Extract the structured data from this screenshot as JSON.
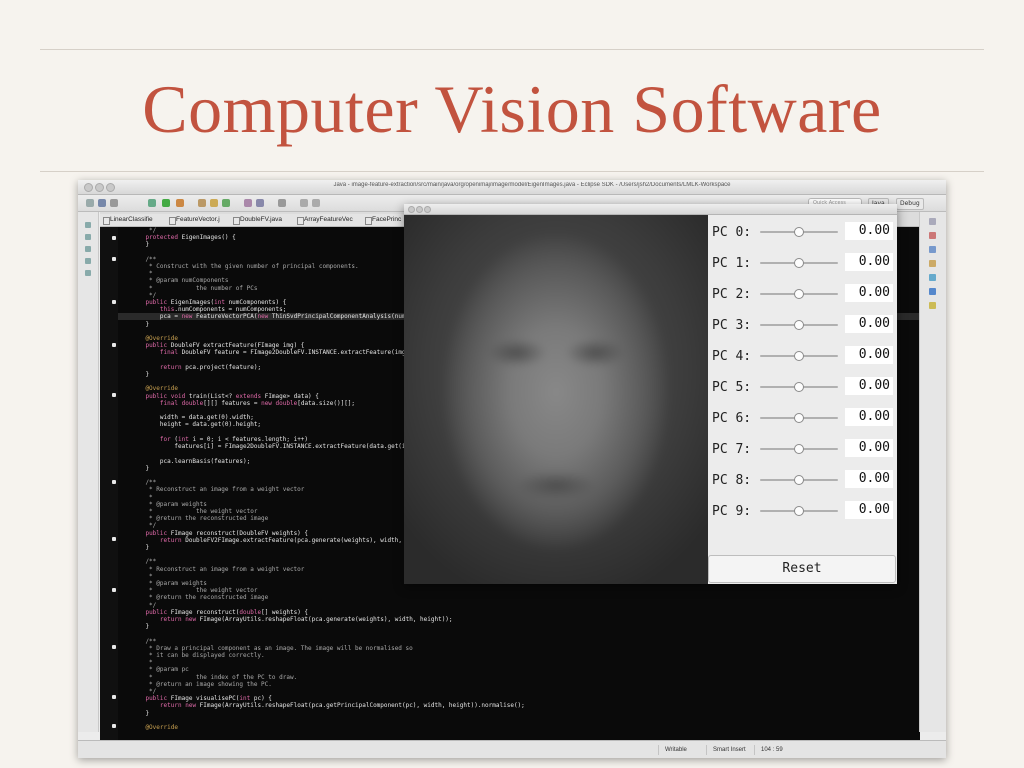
{
  "slide": {
    "title": "Computer Vision Software"
  },
  "eclipse": {
    "window_title": "Java - image-feature-extraction/src/main/java/org/openimaj/image/model/EigenImages.java - Eclipse SDK - /Users/jsh2/Documents/LMLK-Workspace",
    "quick_access": "Quick Access",
    "perspectives": [
      "Java",
      "Debug"
    ],
    "tabs": [
      "LinearClassifie",
      "FeatureVector.j",
      "DoubleFV.java",
      "ArrayFeatureVec",
      "FacePrinc"
    ],
    "code_lines": [
      "     */",
      "    protected EigenImages() {",
      "    }",
      "",
      "    /**",
      "     * Construct with the given number of principal components.",
      "     *",
      "     * @param numComponents",
      "     *            the number of PCs",
      "     */",
      "    public EigenImages(int numComponents) {",
      "        this.numComponents = numComponents;",
      "        pca = new FeatureVectorPCA(new ThinSvdPrincipalComponentAnalysis(numComponent",
      "    }",
      "",
      "    @Override",
      "    public DoubleFV extractFeature(FImage img) {",
      "        final DoubleFV feature = FImage2DoubleFV.INSTANCE.extractFeature(img);",
      "",
      "        return pca.project(feature);",
      "    }",
      "",
      "    @Override",
      "    public void train(List<? extends FImage> data) {",
      "        final double[][] features = new double[data.size()][];",
      "",
      "        width = data.get(0).width;",
      "        height = data.get(0).height;",
      "",
      "        for (int i = 0; i < features.length; i++)",
      "            features[i] = FImage2DoubleFV.INSTANCE.extractFeature(data.get(i)).values",
      "",
      "        pca.learnBasis(features);",
      "    }",
      "",
      "    /**",
      "     * Reconstruct an image from a weight vector",
      "     *",
      "     * @param weights",
      "     *            the weight vector",
      "     * @return the reconstructed image",
      "     */",
      "    public FImage reconstruct(DoubleFV weights) {",
      "        return DoubleFV2FImage.extractFeature(pca.generate(weights), width, height);",
      "    }",
      "",
      "    /**",
      "     * Reconstruct an image from a weight vector",
      "     *",
      "     * @param weights",
      "     *            the weight vector",
      "     * @return the reconstructed image",
      "     */",
      "    public FImage reconstruct(double[] weights) {",
      "        return new FImage(ArrayUtils.reshapeFloat(pca.generate(weights), width, height));",
      "    }",
      "",
      "    /**",
      "     * Draw a principal component as an image. The image will be normalised so",
      "     * it can be displayed correctly.",
      "     *",
      "     * @param pc",
      "     *            the index of the PC to draw.",
      "     * @return an image showing the PC.",
      "     */",
      "    public FImage visualisePC(int pc) {",
      "        return new FImage(ArrayUtils.reshapeFloat(pca.getPrincipalComponent(pc), width, height)).normalise();",
      "    }",
      "",
      "    @Override"
    ],
    "status": {
      "writable": "Writable",
      "insert_mode": "Smart Insert",
      "position": "104 : 59"
    }
  },
  "pca_window": {
    "rows": [
      {
        "label": "PC 0:",
        "value": "0.00",
        "slider_fraction": 0.5
      },
      {
        "label": "PC 1:",
        "value": "0.00",
        "slider_fraction": 0.5
      },
      {
        "label": "PC 2:",
        "value": "0.00",
        "slider_fraction": 0.5
      },
      {
        "label": "PC 3:",
        "value": "0.00",
        "slider_fraction": 0.5
      },
      {
        "label": "PC 4:",
        "value": "0.00",
        "slider_fraction": 0.5
      },
      {
        "label": "PC 5:",
        "value": "0.00",
        "slider_fraction": 0.5
      },
      {
        "label": "PC 6:",
        "value": "0.00",
        "slider_fraction": 0.5
      },
      {
        "label": "PC 7:",
        "value": "0.00",
        "slider_fraction": 0.5
      },
      {
        "label": "PC 8:",
        "value": "0.00",
        "slider_fraction": 0.5
      },
      {
        "label": "PC 9:",
        "value": "0.00",
        "slider_fraction": 0.5
      }
    ],
    "reset_label": "Reset"
  },
  "colors": {
    "title": "#c2533f",
    "editor_bg": "#0a0a0a",
    "keyword": "#e06aa9",
    "type": "#7fd6e6"
  }
}
